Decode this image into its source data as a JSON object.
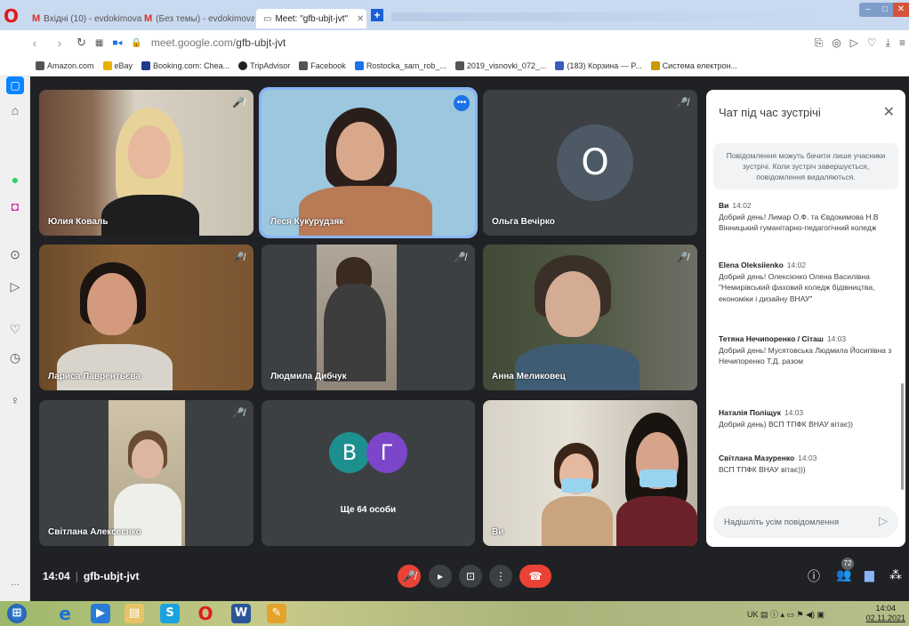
{
  "browser": {
    "tabs": [
      {
        "label": "Вхідні (10) - evdokimovan...",
        "prefix": "M"
      },
      {
        "label": "(Без темы) - evdokimovan...",
        "prefix": "M"
      },
      {
        "label": "Meet: \"gfb-ubjt-jvt\"",
        "prefix": ""
      }
    ],
    "url_host": "meet.google.com/",
    "url_path": "gfb-ubjt-jvt"
  },
  "bookmarks": [
    {
      "label": "Amazon.com",
      "color": "#555555"
    },
    {
      "label": "eBay",
      "color": "#e7b100"
    },
    {
      "label": "Booking.com: Chea...",
      "color": "#1b3d8a"
    },
    {
      "label": "TripAdvisor",
      "color": "#222222"
    },
    {
      "label": "Facebook",
      "color": "#555555"
    },
    {
      "label": "Rostocka_sam_rob_...",
      "color": "#1a73e8"
    },
    {
      "label": "2019_visnovki_072_...",
      "color": "#555555"
    },
    {
      "label": "(183) Корзина — P...",
      "color": "#3b5bbd"
    },
    {
      "label": "Система електрон...",
      "color": "#c99a00"
    }
  ],
  "participants": [
    {
      "name": "Юлия Коваль",
      "muted": true
    },
    {
      "name": "Леся Кукурудзяк",
      "muted": false
    },
    {
      "name": "Ольга Вечірко",
      "muted": true,
      "initial": "О"
    },
    {
      "name": "Лариса Лаврентьєва",
      "muted": true
    },
    {
      "name": "Людмила Дибчук",
      "muted": true
    },
    {
      "name": "Анна Меликовец",
      "muted": true
    },
    {
      "name": "Світлана Алексеєнко",
      "muted": true
    },
    {
      "name": "Ви",
      "muted": false
    }
  ],
  "others_tile": {
    "initials": [
      "В",
      "Г"
    ],
    "label": "Ще 64 особи"
  },
  "controls": {
    "time": "14:04",
    "meeting_code": "gfb-ubjt-jvt",
    "participant_count": "72"
  },
  "chat": {
    "title": "Чат під час зустрічі",
    "notice": "Повідомлення можуть бачити лише учасники зустрічі. Коли зустріч завершується, повідомлення видаляються.",
    "messages": [
      {
        "sender": "Ви",
        "time": "14:02",
        "text": "Добрий день! Лимар О.Ф. та Євдокимова Н.В Вінницький гуманітарно-педагогічний коледж"
      },
      {
        "sender": "Elena Oleksiienko",
        "time": "14:02",
        "text": "Добрий день! Олексієнко Олена Василівна \"Немирівський фаховий коледж бідівництва, економіки і дизайну ВНАУ\""
      },
      {
        "sender": "Тетяна Нечипоренко / Сіташ",
        "time": "14:03",
        "text": "Добрий день! Мусятовська Людмила Йосипівна з Нечипоренко Т.Д. разом"
      },
      {
        "sender": "Наталія Поліщук",
        "time": "14:03",
        "text": "Добрий день) ВСП ТПФК ВНАУ вітає))"
      },
      {
        "sender": "Світлана Мазуренко",
        "time": "14:03",
        "text": "ВСП ТПФК ВНАУ вітає)))"
      }
    ],
    "input_placeholder": "Надішліть усім повідомлення"
  },
  "taskbar": {
    "lang": "UK",
    "time": "14:04",
    "date": "02.11.2021"
  }
}
